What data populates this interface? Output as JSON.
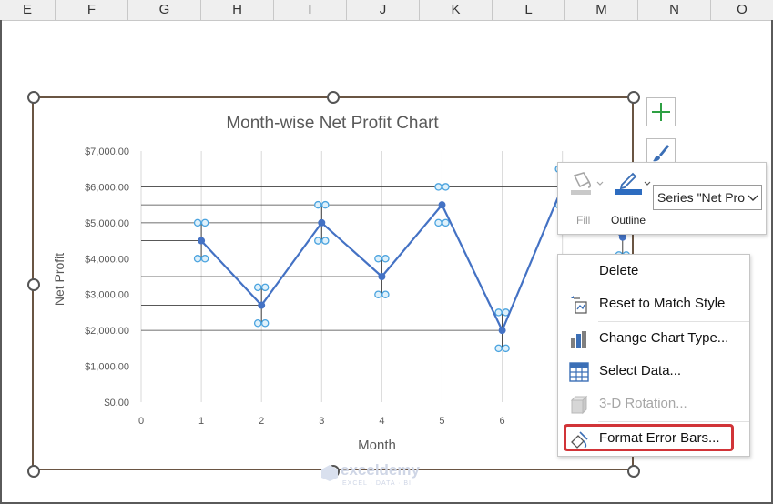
{
  "columns": [
    "E",
    "F",
    "G",
    "H",
    "I",
    "J",
    "K",
    "L",
    "M",
    "N",
    "O"
  ],
  "chart_data": {
    "type": "line",
    "title": "Month-wise Net Profit Chart",
    "xlabel": "Month",
    "ylabel": "Net Profit",
    "x": [
      1,
      2,
      3,
      4,
      5,
      6,
      7,
      8
    ],
    "x_ticks": [
      "0",
      "1",
      "2",
      "3",
      "4",
      "5",
      "6",
      "7"
    ],
    "xlim": [
      0,
      8.2
    ],
    "ylim": [
      0,
      7000
    ],
    "y_ticks": [
      "$0.00",
      "$1,000.00",
      "$2,000.00",
      "$3,000.00",
      "$4,000.00",
      "$5,000.00",
      "$6,000.00",
      "$7,000.00"
    ],
    "series": [
      {
        "values": [
          4500,
          2700,
          5000,
          3500,
          5500,
          2000,
          6000,
          4600
        ]
      }
    ],
    "error_bars": {
      "upper": [
        5000,
        3200,
        5500,
        4000,
        6000,
        2500,
        6500,
        5100
      ],
      "lower": [
        4000,
        2200,
        4500,
        3000,
        5000,
        1500,
        5500,
        4100
      ]
    },
    "drop_lines_to_y_axis": true,
    "grid": "vertical",
    "line_color": "#4472c4",
    "error_marker_color": "#4aa3df"
  },
  "mini_toolbar": {
    "fill_label": "Fill",
    "outline_label": "Outline",
    "series_select": "Series \"Net Pro"
  },
  "context_menu": {
    "items": [
      {
        "label": "Delete",
        "icon": "none"
      },
      {
        "label": "Reset to Match Style",
        "icon": "reset-style-icon"
      },
      {
        "label": "Change Chart Type...",
        "icon": "chart-type-icon"
      },
      {
        "label": "Select Data...",
        "icon": "select-data-icon"
      },
      {
        "label": "3-D Rotation...",
        "icon": "rotation-icon",
        "disabled": true
      },
      {
        "label": "Format Error Bars...",
        "icon": "format-icon",
        "highlighted": true
      }
    ]
  },
  "watermark": {
    "name": "exceldemy",
    "tagline": "EXCEL · DATA · BI"
  },
  "colors": {
    "accent": "#4472c4",
    "highlight": "#d13438",
    "chart_border": "#6a5543",
    "add_icon": "#2ea043"
  }
}
